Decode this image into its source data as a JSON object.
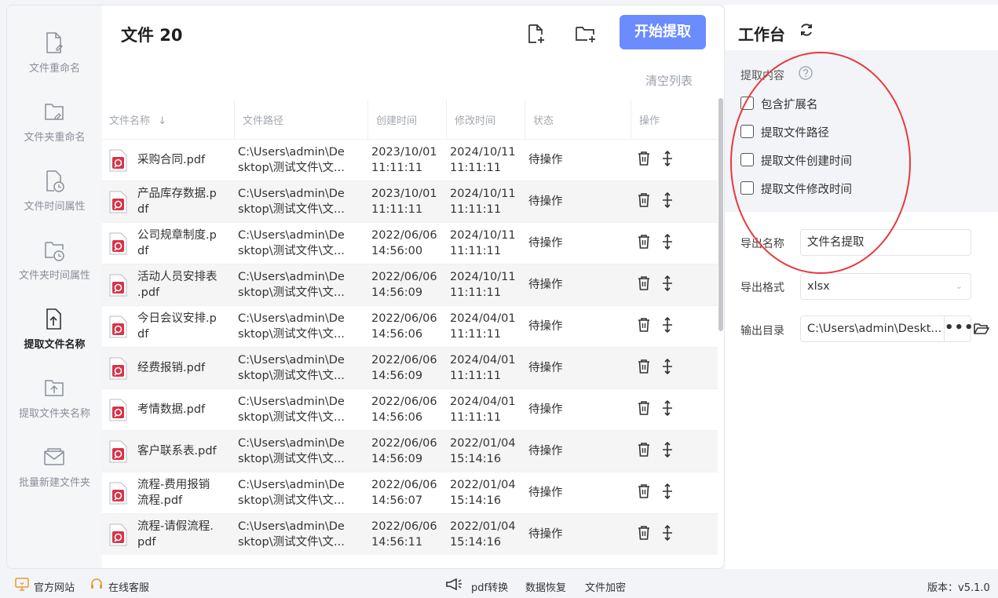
{
  "sidebar": {
    "items": [
      {
        "label": "文件重命名",
        "icon": "file-edit-icon"
      },
      {
        "label": "文件夹重命名",
        "icon": "folder-edit-icon"
      },
      {
        "label": "文件时间属性",
        "icon": "file-clock-icon"
      },
      {
        "label": "文件夹时间属性",
        "icon": "folder-clock-icon"
      },
      {
        "label": "提取文件名称",
        "icon": "file-upload-icon",
        "active": true
      },
      {
        "label": "提取文件夹名称",
        "icon": "folder-upload-icon"
      },
      {
        "label": "批量新建文件夹",
        "icon": "envelope-icon"
      }
    ]
  },
  "header": {
    "title": "文件 20",
    "add_file_icon": "add-file-icon",
    "add_folder_icon": "add-folder-icon",
    "start_label": "开始提取",
    "clear_label": "清空列表"
  },
  "table": {
    "columns": [
      "文件名称",
      "文件路径",
      "创建时间",
      "修改时间",
      "状态",
      "操作"
    ],
    "sort_indicator": "↓",
    "rows": [
      {
        "name": "采购合同.pdf",
        "path": "C:\\Users\\admin\\De\nsktop\\测试文件\\文...",
        "created": "2023/10/01\n11:11:11",
        "modified": "2024/10/11\n11:11:11",
        "status": "待操作"
      },
      {
        "name": "产品库存数据.p\ndf",
        "path": "C:\\Users\\admin\\De\nsktop\\测试文件\\文...",
        "created": "2023/10/01\n11:11:11",
        "modified": "2024/10/11\n11:11:11",
        "status": "待操作"
      },
      {
        "name": "公司规章制度.p\ndf",
        "path": "C:\\Users\\admin\\De\nsktop\\测试文件\\文...",
        "created": "2022/06/06\n14:56:00",
        "modified": "2024/10/11\n11:11:11",
        "status": "待操作"
      },
      {
        "name": "活动人员安排表\n.pdf",
        "path": "C:\\Users\\admin\\De\nsktop\\测试文件\\文...",
        "created": "2022/06/06\n14:56:09",
        "modified": "2024/10/11\n11:11:11",
        "status": "待操作"
      },
      {
        "name": "今日会议安排.p\ndf",
        "path": "C:\\Users\\admin\\De\nsktop\\测试文件\\文...",
        "created": "2022/06/06\n14:56:06",
        "modified": "2024/04/01\n11:11:11",
        "status": "待操作"
      },
      {
        "name": "经费报销.pdf",
        "path": "C:\\Users\\admin\\De\nsktop\\测试文件\\文...",
        "created": "2022/06/06\n14:56:09",
        "modified": "2024/04/01\n11:11:11",
        "status": "待操作"
      },
      {
        "name": "考情数据.pdf",
        "path": "C:\\Users\\admin\\De\nsktop\\测试文件\\文...",
        "created": "2022/06/06\n14:56:06",
        "modified": "2024/04/01\n11:11:11",
        "status": "待操作"
      },
      {
        "name": "客户联系表.pdf",
        "path": "C:\\Users\\admin\\De\nsktop\\测试文件\\文...",
        "created": "2022/06/06\n14:56:09",
        "modified": "2022/01/04\n15:14:16",
        "status": "待操作"
      },
      {
        "name": "流程-费用报销\n流程.pdf",
        "path": "C:\\Users\\admin\\De\nsktop\\测试文件\\文...",
        "created": "2022/06/06\n14:56:07",
        "modified": "2022/01/04\n15:14:16",
        "status": "待操作"
      },
      {
        "name": "流程-请假流程.\npdf",
        "path": "C:\\Users\\admin\\De\nsktop\\测试文件\\文...",
        "created": "2022/06/06\n14:56:11",
        "modified": "2022/01/04\n15:14:16",
        "status": "待操作"
      }
    ]
  },
  "workbench": {
    "title": "工作台",
    "extract_label": "提取内容",
    "options": [
      {
        "label": "包含扩展名",
        "checked": false
      },
      {
        "label": "提取文件路径",
        "checked": false
      },
      {
        "label": "提取文件创建时间",
        "checked": false
      },
      {
        "label": "提取文件修改时间",
        "checked": false
      }
    ],
    "export_name_label": "导出名称",
    "export_name_value": "文件名提取",
    "export_format_label": "导出格式",
    "export_format_value": "xlsx",
    "output_dir_label": "输出目录",
    "output_dir_value": "C:\\Users\\admin\\Deskt...",
    "browse_label": "•••"
  },
  "footer": {
    "website": "官方网站",
    "service": "在线客服",
    "pdf": "pdf转换",
    "recovery": "数据恢复",
    "encrypt": "文件加密",
    "version": "版本：v5.1.0"
  },
  "colors": {
    "accent": "#6b8cff",
    "pdf_icon": "#d8334a",
    "annotation_circle": "#e8383d"
  }
}
